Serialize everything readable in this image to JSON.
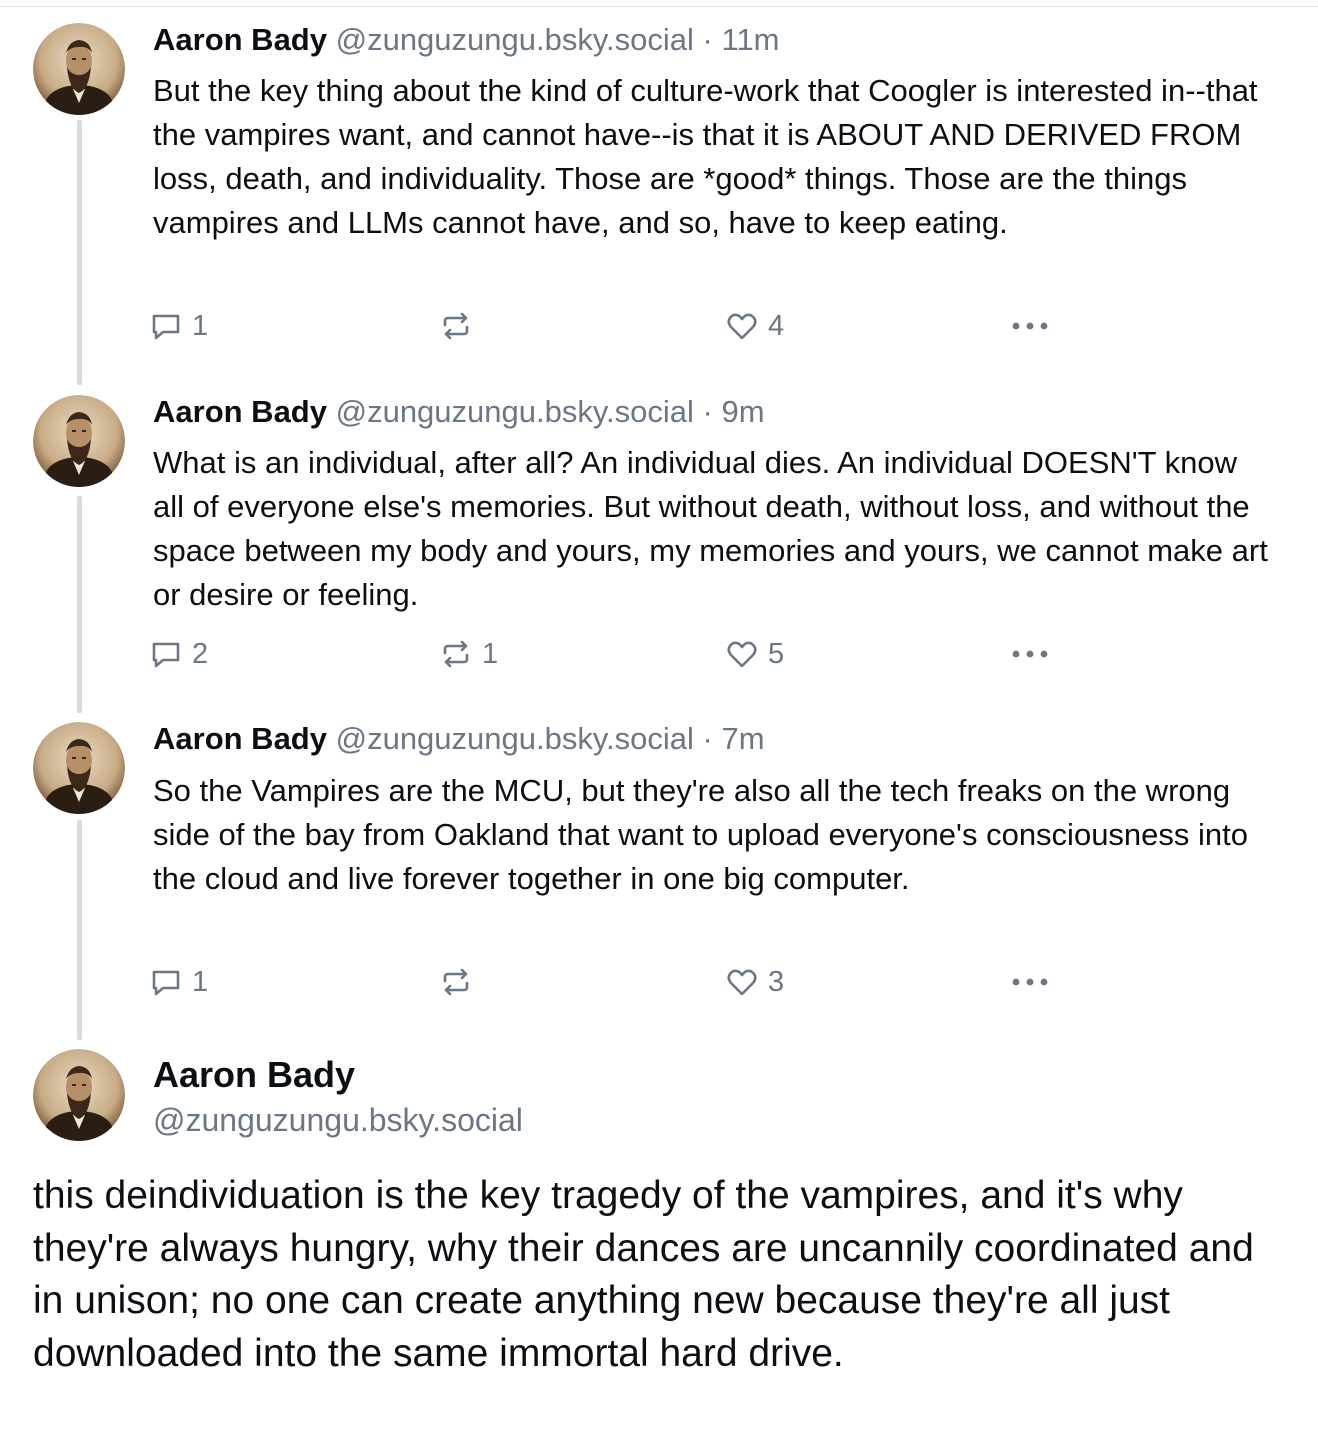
{
  "colors": {
    "text": "#0b0f14",
    "muted": "#6b7785",
    "thread_line": "#d4dbe2"
  },
  "posts": [
    {
      "author_name": "Aaron Bady",
      "author_handle": "@zunguzungu.bsky.social",
      "separator": " · ",
      "time": "11m",
      "text": "But the key thing about the kind of culture-work that Coogler is interested in--that the vampires want, and cannot have--is that it is ABOUT AND DERIVED FROM loss, death, and individuality. Those are *good* things. Those are the things vampires and LLMs cannot have, and so, have to keep eating.",
      "replies": "1",
      "reposts": "",
      "likes": "4"
    },
    {
      "author_name": "Aaron Bady",
      "author_handle": "@zunguzungu.bsky.social",
      "separator": " · ",
      "time": "9m",
      "text": "What is an individual, after all? An individual dies. An individual DOESN'T know all of everyone else's memories. But without death, without loss, and without the space between my body and yours, my memories and yours, we cannot make art or desire or feeling.",
      "replies": "2",
      "reposts": "1",
      "likes": "5"
    },
    {
      "author_name": "Aaron Bady",
      "author_handle": "@zunguzungu.bsky.social",
      "separator": " · ",
      "time": "7m",
      "text": "So the Vampires are the MCU, but they're also all the tech freaks on the wrong side of the bay from Oakland that want to upload everyone's consciousness into the cloud and live forever together in one big computer.",
      "replies": "1",
      "reposts": "",
      "likes": "3"
    }
  ],
  "main_post": {
    "author_name": "Aaron Bady",
    "author_handle": "@zunguzungu.bsky.social",
    "text": "this deindividuation is the key tragedy of the vampires, and it's why they're always hungry, why their dances are uncannily coordinated and in unison; no one can create anything new because they're all just downloaded into the same immortal hard drive."
  },
  "icons": {
    "reply": "speech-bubble-icon",
    "repost": "repost-arrows-icon",
    "like": "heart-icon",
    "more": "ellipsis-icon",
    "avatar": "portrait-photo"
  }
}
